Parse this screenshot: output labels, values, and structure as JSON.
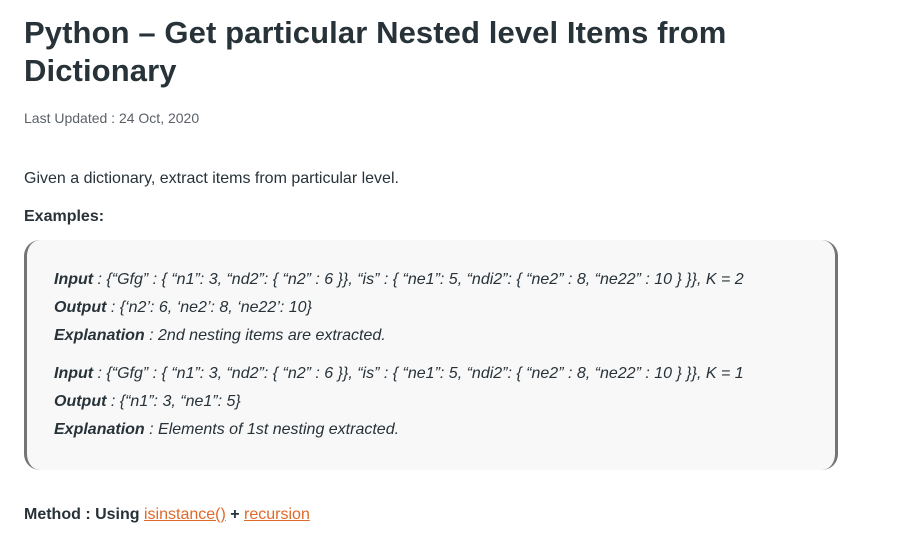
{
  "article": {
    "title": "Python – Get particular Nested level Items from Dictionary",
    "last_updated": "Last Updated : 24 Oct, 2020",
    "intro": "Given a dictionary, extract items from particular level.",
    "examples_heading": "Examples:"
  },
  "examples": [
    {
      "input_label": "Input",
      "input_value": " : {“Gfg” : { “n1”: 3, “nd2”: { “n2” : 6 }}, “is” : { “ne1”: 5, “ndi2”: { “ne2” : 8, “ne22” : 10 } }}, K = 2",
      "output_label": "Output",
      "output_value": " : {‘n2’: 6, ‘ne2’: 8, ‘ne22’: 10}",
      "explanation_label": "Explanation",
      "explanation_value": " : 2nd nesting items are extracted."
    },
    {
      "input_label": "Input",
      "input_value": " : {“Gfg” : { “n1”: 3, “nd2”: { “n2” : 6 }}, “is” : { “ne1”: 5, “ndi2”: { “ne2” : 8, “ne22” : 10 } }}, K = 1",
      "output_label": "Output",
      "output_value": " : {“n1”: 3, “ne1”: 5}",
      "explanation_label": "Explanation",
      "explanation_value": " : Elements of 1st nesting extracted."
    }
  ],
  "method": {
    "prefix": "Method : Using ",
    "link1": "isinstance()",
    "joiner": " + ",
    "link2": "recursion"
  }
}
